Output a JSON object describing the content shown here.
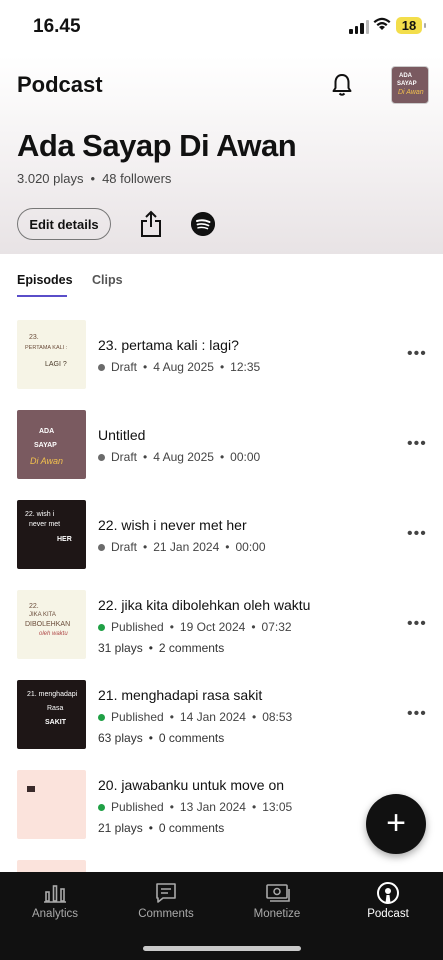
{
  "status_bar": {
    "time": "16.45",
    "battery": "18"
  },
  "header": {
    "title": "Podcast"
  },
  "avatar": {
    "line1": "ADA",
    "line2": "SAYAP",
    "line3": "Di Awan"
  },
  "show": {
    "title": "Ada Sayap Di Awan",
    "plays": "3.020 plays",
    "followers": "48 followers"
  },
  "actions": {
    "edit_label": "Edit details"
  },
  "tabs": [
    {
      "label": "Episodes"
    },
    {
      "label": "Clips"
    }
  ],
  "episodes": [
    {
      "title": "23. pertama kali : lagi?",
      "status": "Draft",
      "date": "4 Aug 2025",
      "duration": "12:35",
      "thumb": [
        "23.",
        "PERTAMA KALI :",
        "LAGI ?"
      ]
    },
    {
      "title": "Untitled",
      "status": "Draft",
      "date": "4 Aug 2025",
      "duration": "00:00",
      "thumb": [
        "ADA",
        "SAYAP",
        "Di Awan"
      ]
    },
    {
      "title": "22. wish i never met her",
      "status": "Draft",
      "date": "21 Jan 2024",
      "duration": "00:00",
      "thumb": [
        "22. wish i",
        "never met",
        "HER"
      ]
    },
    {
      "title": "22. jika kita dibolehkan oleh waktu",
      "status": "Published",
      "date": "19 Oct 2024",
      "duration": "07:32",
      "plays": "31 plays",
      "comments": "2 comments",
      "thumb": [
        "22.",
        "JIKA KITA",
        "DIBOLEHKAN",
        "oleh waktu"
      ]
    },
    {
      "title": "21. menghadapi rasa sakit",
      "status": "Published",
      "date": "14 Jan 2024",
      "duration": "08:53",
      "plays": "63 plays",
      "comments": "0 comments",
      "thumb": [
        "21. menghadapi",
        "Rasa",
        "SAKIT"
      ]
    },
    {
      "title": "20. jawabanku untuk move on",
      "status": "Published",
      "date": "13 Jan 2024",
      "duration": "13:05",
      "plays": "21 plays",
      "comments": "0 comments",
      "thumb": []
    }
  ],
  "status_colors": {
    "Draft": "#6b6b6b",
    "Published": "#1fa045"
  },
  "bottom_nav": [
    {
      "label": "Analytics",
      "icon": "bar-chart-icon"
    },
    {
      "label": "Comments",
      "icon": "comment-icon"
    },
    {
      "label": "Monetize",
      "icon": "money-icon"
    },
    {
      "label": "Podcast",
      "icon": "podcast-icon"
    }
  ]
}
